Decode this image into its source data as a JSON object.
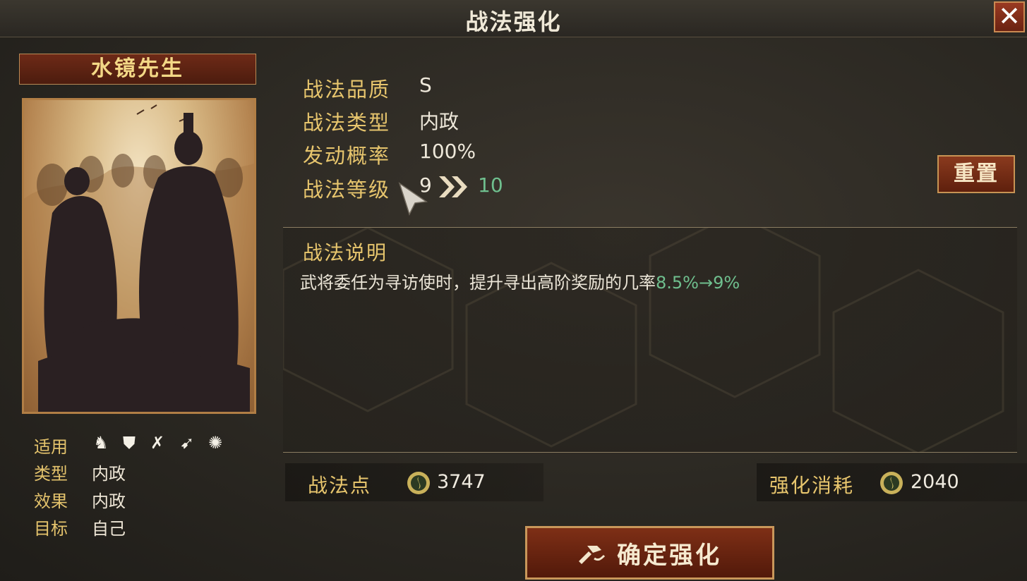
{
  "header": {
    "title": "战法强化",
    "close_label": "✕"
  },
  "general": {
    "name": "水镜先生"
  },
  "tactic_meta": {
    "applies_label": "适用",
    "type_label": "类型",
    "type_value": "内政",
    "effect_label": "效果",
    "effect_value": "内政",
    "target_label": "目标",
    "target_value": "自己",
    "applies_icons": [
      "cavalry-icon",
      "shield-icon",
      "crossed-bows-icon",
      "spear-icon",
      "wheel-icon"
    ]
  },
  "stats": {
    "quality_label": "战法品质",
    "quality_value": "S",
    "category_label": "战法类型",
    "category_value": "内政",
    "rate_label": "发动概率",
    "rate_value": "100%",
    "level_label": "战法等级",
    "level_current": "9",
    "level_next": "10"
  },
  "reset_label": "重置",
  "description": {
    "title": "战法说明",
    "text": "武将委任为寻访使时，提升寻出高阶奖励的几率",
    "value_change": "8.5%→9%"
  },
  "points": {
    "label": "战法点",
    "value": "3747"
  },
  "cost": {
    "label": "强化消耗",
    "value": "2040"
  },
  "confirm_label": "确定强化",
  "colors": {
    "gold_text": "#e7c56d",
    "green_value": "#6fbf8e",
    "button_red": "#7e2f16"
  }
}
